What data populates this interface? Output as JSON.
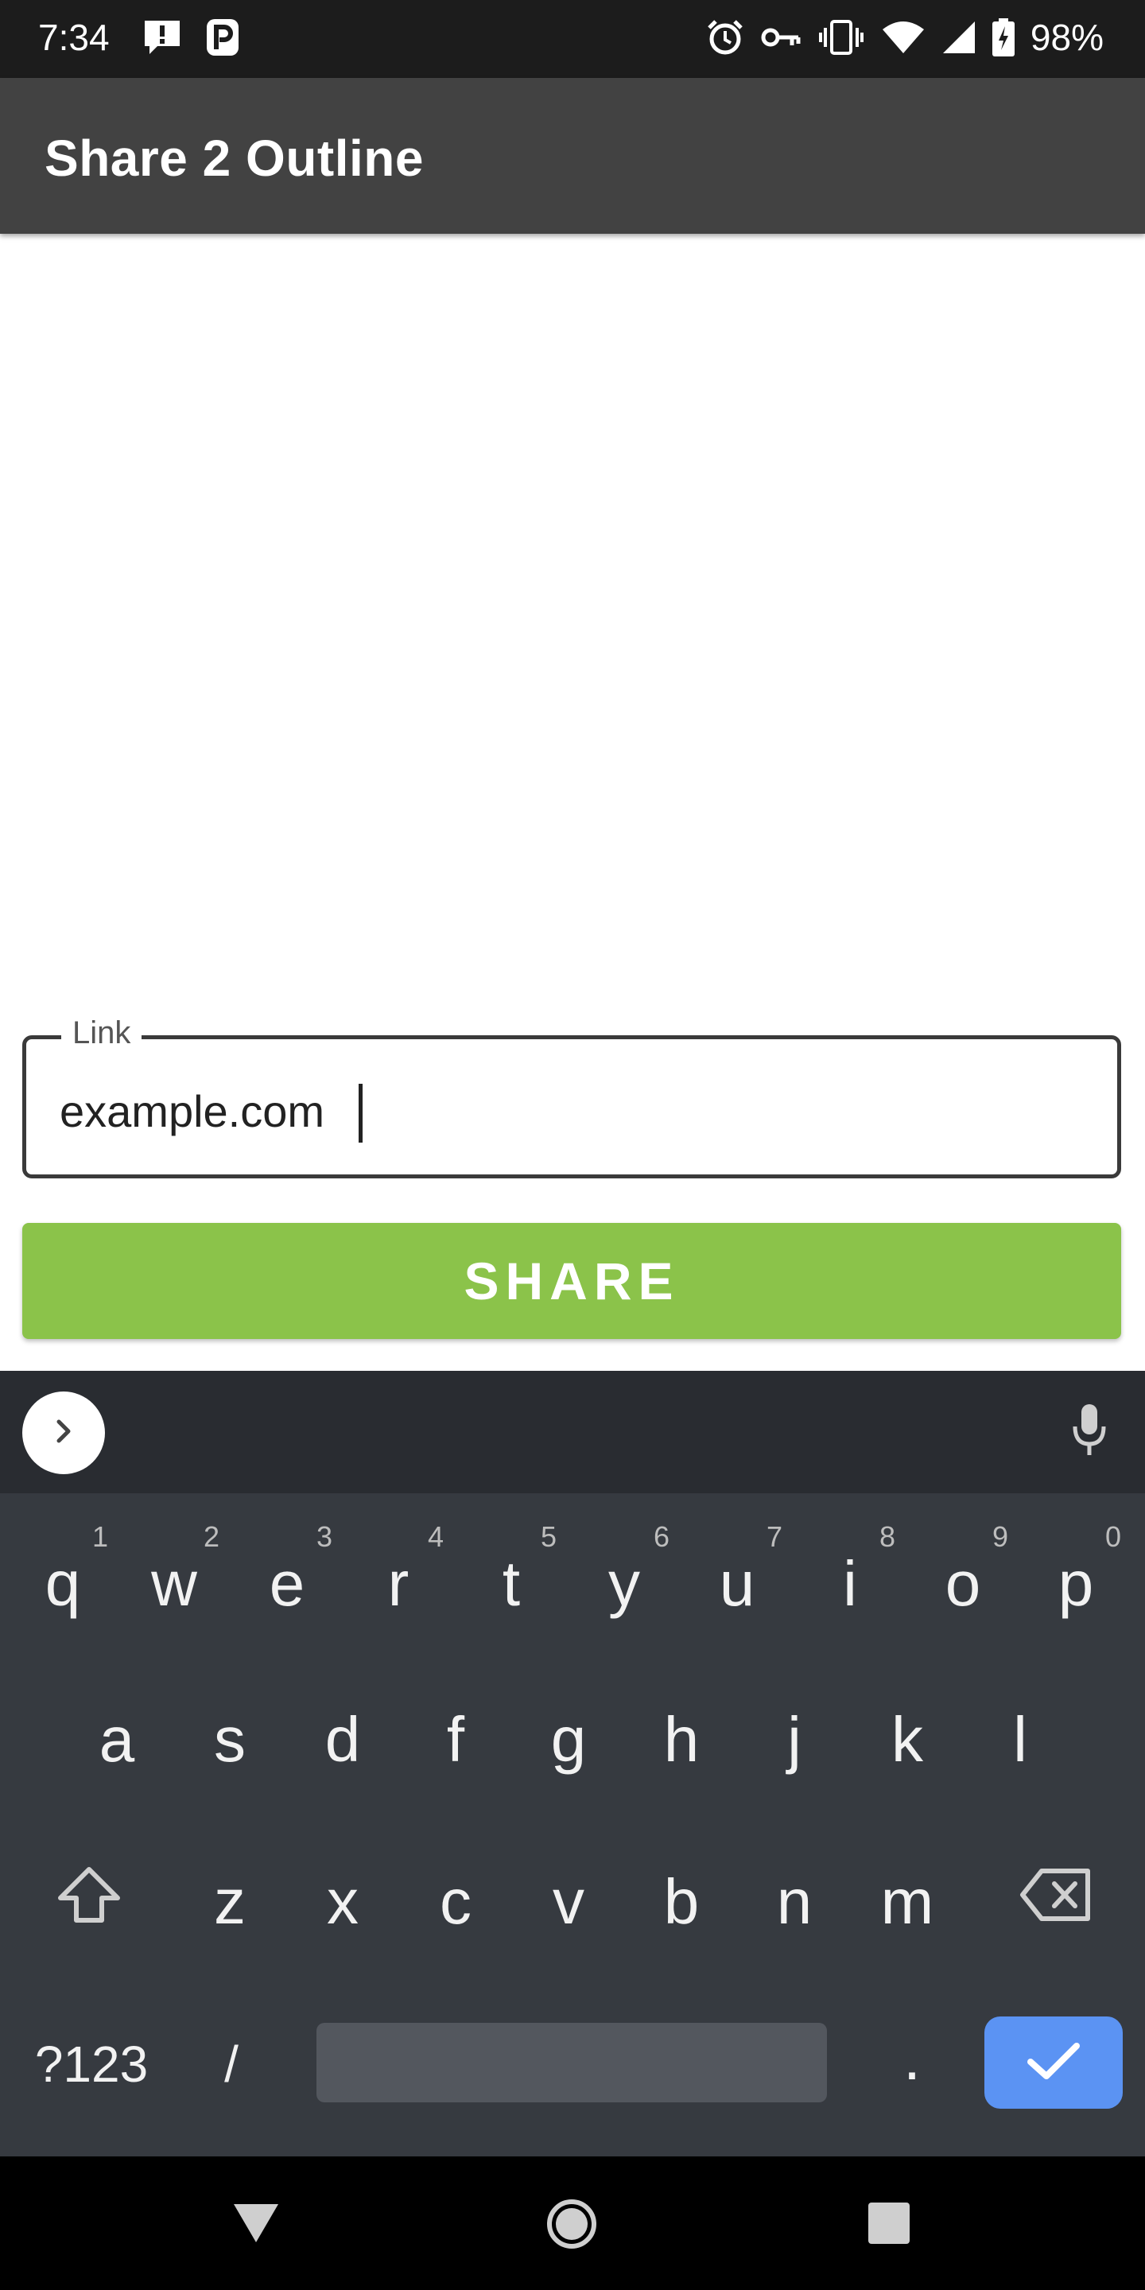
{
  "status_bar": {
    "time": "7:34",
    "battery_percent": "98%",
    "icons": [
      "alert-notification-icon",
      "parking-icon",
      "alarm-icon",
      "vpn-key-icon",
      "vibrate-icon",
      "wifi-icon",
      "cell-signal-icon",
      "battery-charging-icon"
    ]
  },
  "app_bar": {
    "title": "Share 2 Outline"
  },
  "link_field": {
    "label": "Link",
    "value": "example.com"
  },
  "share_button": {
    "label": "SHARE",
    "color": "#8bc34a"
  },
  "keyboard": {
    "row1": [
      {
        "key": "q",
        "hint": "1"
      },
      {
        "key": "w",
        "hint": "2"
      },
      {
        "key": "e",
        "hint": "3"
      },
      {
        "key": "r",
        "hint": "4"
      },
      {
        "key": "t",
        "hint": "5"
      },
      {
        "key": "y",
        "hint": "6"
      },
      {
        "key": "u",
        "hint": "7"
      },
      {
        "key": "i",
        "hint": "8"
      },
      {
        "key": "o",
        "hint": "9"
      },
      {
        "key": "p",
        "hint": "0"
      }
    ],
    "row2": [
      "a",
      "s",
      "d",
      "f",
      "g",
      "h",
      "j",
      "k",
      "l"
    ],
    "row3": [
      "z",
      "x",
      "c",
      "v",
      "b",
      "n",
      "m"
    ],
    "symbols_key": "?123",
    "slash_key": "/",
    "period_key": ".",
    "enter_color": "#5b93f3"
  }
}
